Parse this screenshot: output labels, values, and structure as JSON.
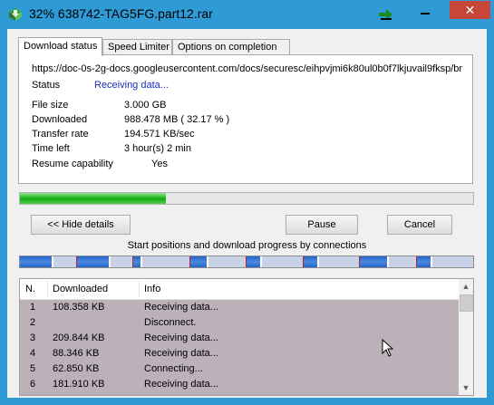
{
  "window": {
    "title": "32% 638742-TAG5FG.part12.rar",
    "close_glyph": "✕"
  },
  "tabs": [
    {
      "label": "Download status",
      "active": true
    },
    {
      "label": "Speed Limiter",
      "active": false
    },
    {
      "label": "Options on completion",
      "active": false
    }
  ],
  "status": {
    "url": "https://doc-0s-2g-docs.googleusercontent.com/docs/securesc/eihpvjmi6k80ul0b0f7lkjuvail9fksp/br",
    "status_label": "Status",
    "status_value": "Receiving data...",
    "file_size_label": "File size",
    "file_size_value": "3.000  GB",
    "downloaded_label": "Downloaded",
    "downloaded_value": "988.478  MB  ( 32.17 % )",
    "transfer_rate_label": "Transfer rate",
    "transfer_rate_value": "194.571  KB/sec",
    "time_left_label": "Time left",
    "time_left_value": "3 hour(s) 2 min",
    "resume_label": "Resume capability",
    "resume_value": "Yes"
  },
  "progress": {
    "fraction": 0.3217
  },
  "buttons": {
    "hide_details": "<< Hide details",
    "pause": "Pause",
    "cancel": "Cancel"
  },
  "connections": {
    "caption": "Start positions and download progress by connections",
    "colors": {
      "track": "#c8d2e6",
      "segment": "#2565c8",
      "marker": "#ffffff",
      "divider": "#c0242e"
    },
    "segments": [
      {
        "start": 0.0,
        "progress": 0.07
      },
      {
        "start": 0.125,
        "progress": 0.07
      },
      {
        "start": 0.25,
        "progress": 0.015
      },
      {
        "start": 0.375,
        "progress": 0.035
      },
      {
        "start": 0.5,
        "progress": 0.03
      },
      {
        "start": 0.625,
        "progress": 0.03
      },
      {
        "start": 0.75,
        "progress": 0.06
      },
      {
        "start": 0.875,
        "progress": 0.03
      }
    ]
  },
  "list": {
    "headers": {
      "n": "N.",
      "downloaded": "Downloaded",
      "info": "Info"
    },
    "row_color": "#bcb1b9",
    "rows": [
      {
        "n": "1",
        "downloaded": "108.358  KB",
        "info": "Receiving data..."
      },
      {
        "n": "2",
        "downloaded": "",
        "info": "Disconnect."
      },
      {
        "n": "3",
        "downloaded": "209.844  KB",
        "info": "Receiving data..."
      },
      {
        "n": "4",
        "downloaded": "88.346  KB",
        "info": "Receiving data..."
      },
      {
        "n": "5",
        "downloaded": "62.850  KB",
        "info": "Connecting..."
      },
      {
        "n": "6",
        "downloaded": "181.910  KB",
        "info": "Receiving data..."
      }
    ]
  }
}
